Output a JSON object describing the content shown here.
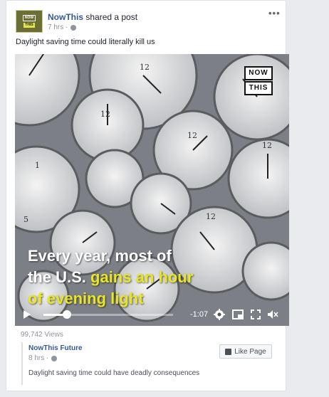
{
  "post": {
    "author": "NowThis",
    "action": "shared a post",
    "time": "7 hrs ·",
    "caption": "Daylight saving time could literally kill us",
    "avatar_text_top": "NOW",
    "avatar_text_bottom": "THIS",
    "more_icon": "more-icon"
  },
  "video": {
    "logo_top": "NOW",
    "logo_bottom": "THIS",
    "overlay_line1": "Every year, most of",
    "overlay_line2_a": "the U.S. ",
    "overlay_line2_b": "gains an hour",
    "overlay_line3": "of evening light",
    "time_remaining": "-1:07",
    "progress": 0.18,
    "overlay_highlight_color": "#e9e622",
    "icons": [
      "play-icon",
      "settings-icon",
      "theater-icon",
      "fullscreen-icon",
      "mute-icon"
    ]
  },
  "views": "99,742 Views",
  "shared": {
    "name": "NowThis Future",
    "time": "8 hrs ·",
    "like_label": "Like Page",
    "caption": "Daylight saving time could have deadly consequences"
  }
}
